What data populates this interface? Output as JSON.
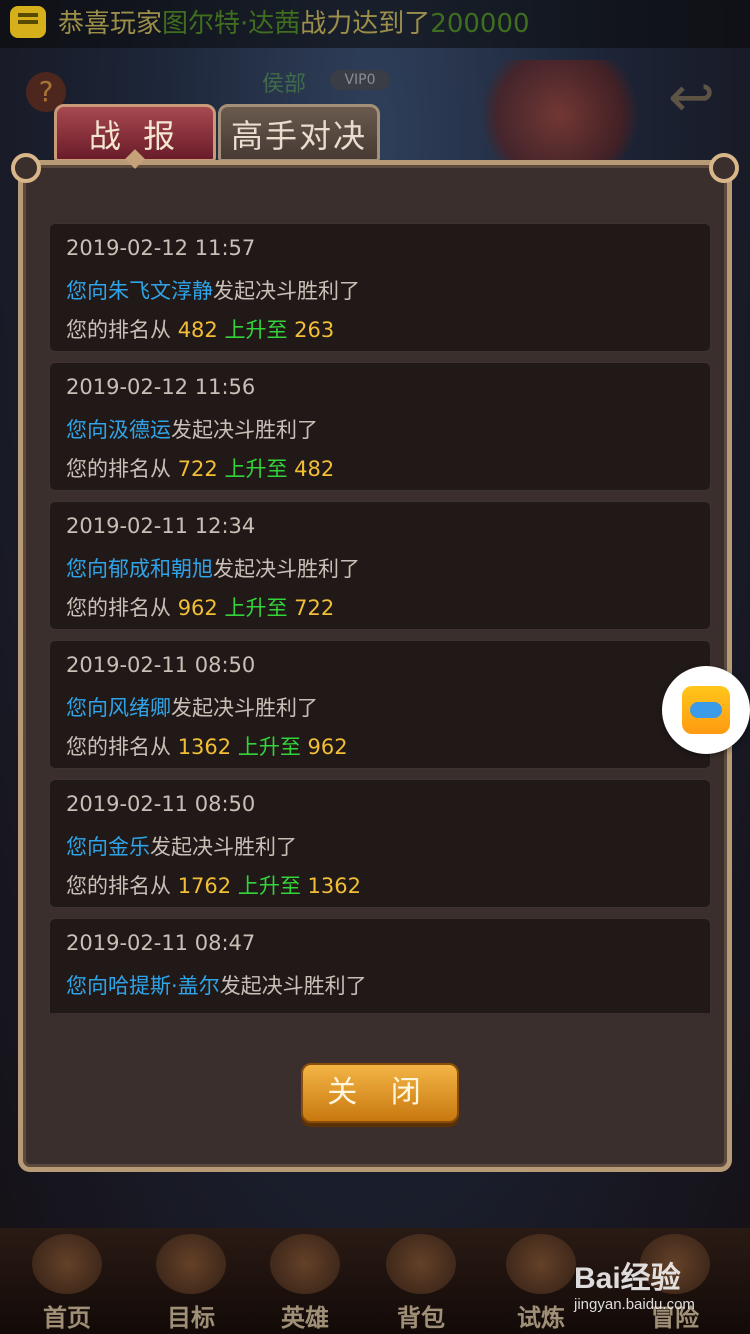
{
  "announcement": {
    "prefix": "恭喜玩家",
    "player": "图尔特·达茜",
    "middle": "战力达到了",
    "value": "200000"
  },
  "background": {
    "player_name": "侯部",
    "vip": "VIP0"
  },
  "tabs": [
    {
      "label": "战 报",
      "active": true
    },
    {
      "label": "高手对决",
      "active": false
    }
  ],
  "battle_reports": [
    {
      "date": "2019-02-12 11:57",
      "prefix": "您向",
      "opponent": "朱飞文淳静",
      "result": "发起决斗胜利了",
      "rank_label": "您的排名从",
      "from": "482",
      "change": "上升至",
      "to": "263"
    },
    {
      "date": "2019-02-12 11:56",
      "prefix": "您向",
      "opponent": "汲德运",
      "result": "发起决斗胜利了",
      "rank_label": "您的排名从",
      "from": "722",
      "change": "上升至",
      "to": "482"
    },
    {
      "date": "2019-02-11 12:34",
      "prefix": "您向",
      "opponent": "郁成和朝旭",
      "result": "发起决斗胜利了",
      "rank_label": "您的排名从",
      "from": "962",
      "change": "上升至",
      "to": "722"
    },
    {
      "date": "2019-02-11 08:50",
      "prefix": "您向",
      "opponent": "风绪卿",
      "result": "发起决斗胜利了",
      "rank_label": "您的排名从",
      "from": "1362",
      "change": "上升至",
      "to": "962"
    },
    {
      "date": "2019-02-11 08:50",
      "prefix": "您向",
      "opponent": "金乐",
      "result": "发起决斗胜利了",
      "rank_label": "您的排名从",
      "from": "1762",
      "change": "上升至",
      "to": "1362"
    },
    {
      "date": "2019-02-11 08:47",
      "prefix": "您向",
      "opponent": "哈提斯·盖尔",
      "result": "发起决斗胜利了",
      "rank_label": "",
      "from": "",
      "change": "",
      "to": ""
    }
  ],
  "close_label": "关 闭",
  "bottom_nav": [
    {
      "label": "首页"
    },
    {
      "label": "目标"
    },
    {
      "label": "英雄"
    },
    {
      "label": "背包"
    },
    {
      "label": "试炼"
    },
    {
      "label": "冒险"
    }
  ],
  "watermark": {
    "brand": "Bai经验",
    "url": "jingyan.baidu.com"
  },
  "colors": {
    "opponent": "#2fa4e8",
    "rank_number": "#f2be35",
    "rank_change": "#33d33a",
    "close_button": "#e39a2a"
  }
}
